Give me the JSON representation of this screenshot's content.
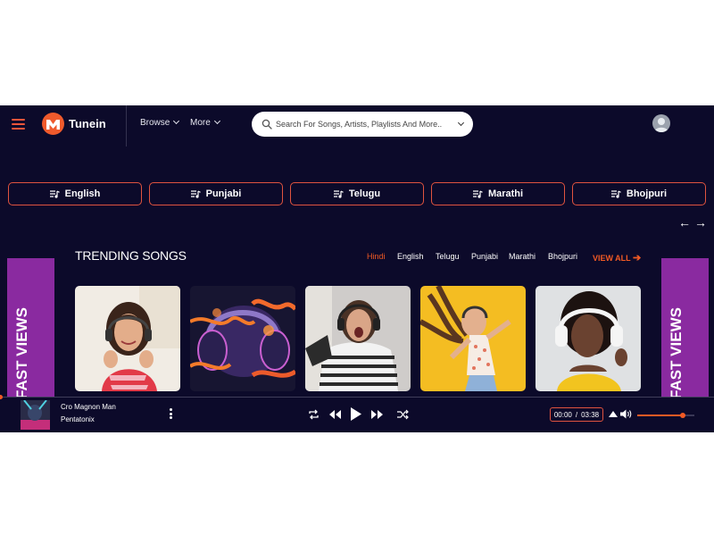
{
  "app": {
    "name": "Tunein"
  },
  "nav": {
    "browse": "Browse",
    "more": "More"
  },
  "search": {
    "placeholder": "Search For Songs, Artists, Playlists And More.."
  },
  "languages": [
    {
      "label": "English",
      "icon": "playlist-icon"
    },
    {
      "label": "Punjabi",
      "icon": "playlist-icon"
    },
    {
      "label": "Telugu",
      "icon": "playlist-icon"
    },
    {
      "label": "Marathi",
      "icon": "playlist-icon"
    },
    {
      "label": "Bhojpuri",
      "icon": "playlist-icon"
    }
  ],
  "carousel": {
    "prev": "←",
    "next": "→"
  },
  "trending": {
    "title": "TRENDING SONGS",
    "filters": [
      "Hindi",
      "English",
      "Telugu",
      "Punjabi",
      "Marathi",
      "Bhojpuri"
    ],
    "active_filter": "Hindi",
    "view_all": "VIEW ALL"
  },
  "ad": {
    "text_left": "FAST VIEWS",
    "text_right": "FAST VIEWS"
  },
  "player": {
    "title": "Cro Magnon Man",
    "artist": "Pentatonix",
    "current_time": "00:00",
    "time_sep": "/",
    "duration": "03:38",
    "progress": 0,
    "volume": 0.8
  },
  "colors": {
    "accent": "#f15a24",
    "background": "#0c0a2a",
    "border": "#e0533f",
    "ad": "#8a2aa0"
  }
}
